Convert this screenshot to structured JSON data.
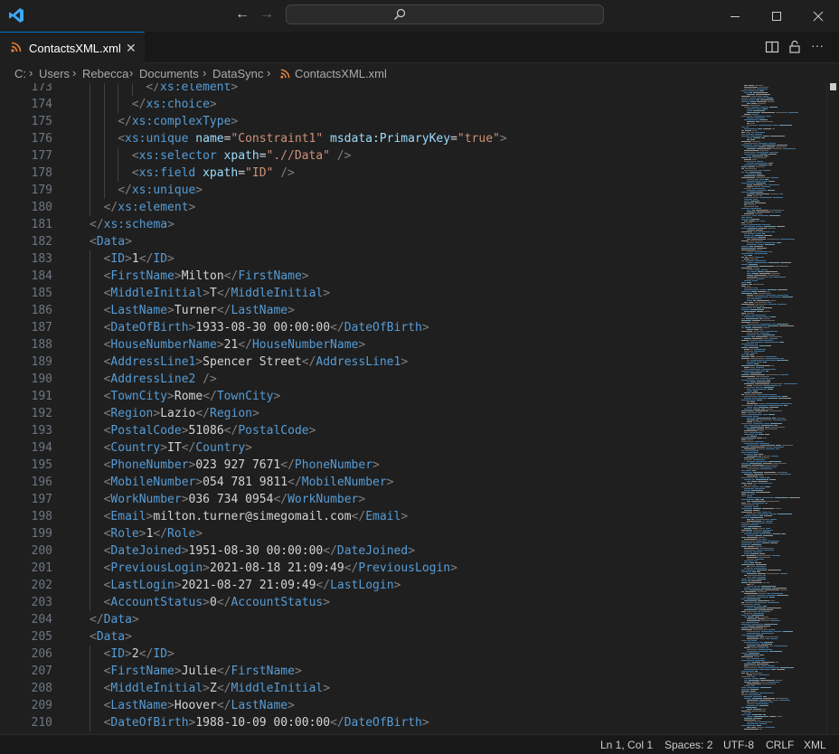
{
  "window": {
    "app_icon": "vscode-logo-icon",
    "nav_back_icon": "arrow-left-icon",
    "nav_forward_icon": "arrow-right-icon",
    "search_icon": "search-icon",
    "minimize_icon": "minimize-icon",
    "maximize_icon": "maximize-icon",
    "close_icon": "close-icon"
  },
  "tab": {
    "label": "ContactsXML.xml",
    "close": "✕",
    "icon": "rss-icon",
    "accent": "#0078d4"
  },
  "toolbar": {
    "split_icon": "split-editor-icon",
    "lock_icon": "lock-icon",
    "more": "···"
  },
  "breadcrumb": [
    "C:",
    "Users",
    "Rebecca",
    "Documents",
    "DataSync",
    "ContactsXML.xml"
  ],
  "lines": [
    {
      "n": "173",
      "indent": 4,
      "seg": [
        [
          "punct",
          "</"
        ],
        [
          "tag",
          "xs:element"
        ],
        [
          "punct",
          ">"
        ]
      ]
    },
    {
      "n": "174",
      "indent": 3,
      "seg": [
        [
          "punct",
          "</"
        ],
        [
          "tag",
          "xs:choice"
        ],
        [
          "punct",
          ">"
        ]
      ]
    },
    {
      "n": "175",
      "indent": 2,
      "seg": [
        [
          "punct",
          "</"
        ],
        [
          "tag",
          "xs:complexType"
        ],
        [
          "punct",
          ">"
        ]
      ]
    },
    {
      "n": "176",
      "indent": 2,
      "seg": [
        [
          "punct",
          "<"
        ],
        [
          "tag",
          "xs:unique"
        ],
        [
          "text",
          " "
        ],
        [
          "attr",
          "name"
        ],
        [
          "text",
          "="
        ],
        [
          "str",
          "\"Constraint1\""
        ],
        [
          "text",
          " "
        ],
        [
          "attr",
          "msdata:PrimaryKey"
        ],
        [
          "text",
          "="
        ],
        [
          "str",
          "\"true\""
        ],
        [
          "punct",
          ">"
        ]
      ]
    },
    {
      "n": "177",
      "indent": 3,
      "seg": [
        [
          "punct",
          "<"
        ],
        [
          "tag",
          "xs:selector"
        ],
        [
          "text",
          " "
        ],
        [
          "attr",
          "xpath"
        ],
        [
          "text",
          "="
        ],
        [
          "str",
          "\".//Data\""
        ],
        [
          "text",
          " "
        ],
        [
          "punct",
          "/>"
        ]
      ]
    },
    {
      "n": "178",
      "indent": 3,
      "seg": [
        [
          "punct",
          "<"
        ],
        [
          "tag",
          "xs:field"
        ],
        [
          "text",
          " "
        ],
        [
          "attr",
          "xpath"
        ],
        [
          "text",
          "="
        ],
        [
          "str",
          "\"ID\""
        ],
        [
          "text",
          " "
        ],
        [
          "punct",
          "/>"
        ]
      ]
    },
    {
      "n": "179",
      "indent": 2,
      "seg": [
        [
          "punct",
          "</"
        ],
        [
          "tag",
          "xs:unique"
        ],
        [
          "punct",
          ">"
        ]
      ]
    },
    {
      "n": "180",
      "indent": 1,
      "seg": [
        [
          "punct",
          "</"
        ],
        [
          "tag",
          "xs:element"
        ],
        [
          "punct",
          ">"
        ]
      ]
    },
    {
      "n": "181",
      "indent": 0,
      "seg": [
        [
          "punct",
          "</"
        ],
        [
          "tag",
          "xs:schema"
        ],
        [
          "punct",
          ">"
        ]
      ]
    },
    {
      "n": "182",
      "indent": 0,
      "seg": [
        [
          "punct",
          "<"
        ],
        [
          "tag",
          "Data"
        ],
        [
          "punct",
          ">"
        ]
      ]
    },
    {
      "n": "183",
      "indent": 1,
      "seg": [
        [
          "punct",
          "<"
        ],
        [
          "tag",
          "ID"
        ],
        [
          "punct",
          ">"
        ],
        [
          "text",
          "1"
        ],
        [
          "punct",
          "</"
        ],
        [
          "tag",
          "ID"
        ],
        [
          "punct",
          ">"
        ]
      ]
    },
    {
      "n": "184",
      "indent": 1,
      "seg": [
        [
          "punct",
          "<"
        ],
        [
          "tag",
          "FirstName"
        ],
        [
          "punct",
          ">"
        ],
        [
          "text",
          "Milton"
        ],
        [
          "punct",
          "</"
        ],
        [
          "tag",
          "FirstName"
        ],
        [
          "punct",
          ">"
        ]
      ]
    },
    {
      "n": "185",
      "indent": 1,
      "seg": [
        [
          "punct",
          "<"
        ],
        [
          "tag",
          "MiddleInitial"
        ],
        [
          "punct",
          ">"
        ],
        [
          "text",
          "T"
        ],
        [
          "punct",
          "</"
        ],
        [
          "tag",
          "MiddleInitial"
        ],
        [
          "punct",
          ">"
        ]
      ]
    },
    {
      "n": "186",
      "indent": 1,
      "seg": [
        [
          "punct",
          "<"
        ],
        [
          "tag",
          "LastName"
        ],
        [
          "punct",
          ">"
        ],
        [
          "text",
          "Turner"
        ],
        [
          "punct",
          "</"
        ],
        [
          "tag",
          "LastName"
        ],
        [
          "punct",
          ">"
        ]
      ]
    },
    {
      "n": "187",
      "indent": 1,
      "seg": [
        [
          "punct",
          "<"
        ],
        [
          "tag",
          "DateOfBirth"
        ],
        [
          "punct",
          ">"
        ],
        [
          "text",
          "1933-08-30 00:00:00"
        ],
        [
          "punct",
          "</"
        ],
        [
          "tag",
          "DateOfBirth"
        ],
        [
          "punct",
          ">"
        ]
      ]
    },
    {
      "n": "188",
      "indent": 1,
      "seg": [
        [
          "punct",
          "<"
        ],
        [
          "tag",
          "HouseNumberName"
        ],
        [
          "punct",
          ">"
        ],
        [
          "text",
          "21"
        ],
        [
          "punct",
          "</"
        ],
        [
          "tag",
          "HouseNumberName"
        ],
        [
          "punct",
          ">"
        ]
      ]
    },
    {
      "n": "189",
      "indent": 1,
      "seg": [
        [
          "punct",
          "<"
        ],
        [
          "tag",
          "AddressLine1"
        ],
        [
          "punct",
          ">"
        ],
        [
          "text",
          "Spencer Street"
        ],
        [
          "punct",
          "</"
        ],
        [
          "tag",
          "AddressLine1"
        ],
        [
          "punct",
          ">"
        ]
      ]
    },
    {
      "n": "190",
      "indent": 1,
      "seg": [
        [
          "punct",
          "<"
        ],
        [
          "tag",
          "AddressLine2"
        ],
        [
          "text",
          " "
        ],
        [
          "punct",
          "/>"
        ]
      ]
    },
    {
      "n": "191",
      "indent": 1,
      "seg": [
        [
          "punct",
          "<"
        ],
        [
          "tag",
          "TownCity"
        ],
        [
          "punct",
          ">"
        ],
        [
          "text",
          "Rome"
        ],
        [
          "punct",
          "</"
        ],
        [
          "tag",
          "TownCity"
        ],
        [
          "punct",
          ">"
        ]
      ]
    },
    {
      "n": "192",
      "indent": 1,
      "seg": [
        [
          "punct",
          "<"
        ],
        [
          "tag",
          "Region"
        ],
        [
          "punct",
          ">"
        ],
        [
          "text",
          "Lazio"
        ],
        [
          "punct",
          "</"
        ],
        [
          "tag",
          "Region"
        ],
        [
          "punct",
          ">"
        ]
      ]
    },
    {
      "n": "193",
      "indent": 1,
      "seg": [
        [
          "punct",
          "<"
        ],
        [
          "tag",
          "PostalCode"
        ],
        [
          "punct",
          ">"
        ],
        [
          "text",
          "51086"
        ],
        [
          "punct",
          "</"
        ],
        [
          "tag",
          "PostalCode"
        ],
        [
          "punct",
          ">"
        ]
      ]
    },
    {
      "n": "194",
      "indent": 1,
      "seg": [
        [
          "punct",
          "<"
        ],
        [
          "tag",
          "Country"
        ],
        [
          "punct",
          ">"
        ],
        [
          "text",
          "IT"
        ],
        [
          "punct",
          "</"
        ],
        [
          "tag",
          "Country"
        ],
        [
          "punct",
          ">"
        ]
      ]
    },
    {
      "n": "195",
      "indent": 1,
      "seg": [
        [
          "punct",
          "<"
        ],
        [
          "tag",
          "PhoneNumber"
        ],
        [
          "punct",
          ">"
        ],
        [
          "text",
          "023 927 7671"
        ],
        [
          "punct",
          "</"
        ],
        [
          "tag",
          "PhoneNumber"
        ],
        [
          "punct",
          ">"
        ]
      ]
    },
    {
      "n": "196",
      "indent": 1,
      "seg": [
        [
          "punct",
          "<"
        ],
        [
          "tag",
          "MobileNumber"
        ],
        [
          "punct",
          ">"
        ],
        [
          "text",
          "054 781 9811"
        ],
        [
          "punct",
          "</"
        ],
        [
          "tag",
          "MobileNumber"
        ],
        [
          "punct",
          ">"
        ]
      ]
    },
    {
      "n": "197",
      "indent": 1,
      "seg": [
        [
          "punct",
          "<"
        ],
        [
          "tag",
          "WorkNumber"
        ],
        [
          "punct",
          ">"
        ],
        [
          "text",
          "036 734 0954"
        ],
        [
          "punct",
          "</"
        ],
        [
          "tag",
          "WorkNumber"
        ],
        [
          "punct",
          ">"
        ]
      ]
    },
    {
      "n": "198",
      "indent": 1,
      "seg": [
        [
          "punct",
          "<"
        ],
        [
          "tag",
          "Email"
        ],
        [
          "punct",
          ">"
        ],
        [
          "text",
          "milton.turner@simegomail.com"
        ],
        [
          "punct",
          "</"
        ],
        [
          "tag",
          "Email"
        ],
        [
          "punct",
          ">"
        ]
      ]
    },
    {
      "n": "199",
      "indent": 1,
      "seg": [
        [
          "punct",
          "<"
        ],
        [
          "tag",
          "Role"
        ],
        [
          "punct",
          ">"
        ],
        [
          "text",
          "1"
        ],
        [
          "punct",
          "</"
        ],
        [
          "tag",
          "Role"
        ],
        [
          "punct",
          ">"
        ]
      ]
    },
    {
      "n": "200",
      "indent": 1,
      "seg": [
        [
          "punct",
          "<"
        ],
        [
          "tag",
          "DateJoined"
        ],
        [
          "punct",
          ">"
        ],
        [
          "text",
          "1951-08-30 00:00:00"
        ],
        [
          "punct",
          "</"
        ],
        [
          "tag",
          "DateJoined"
        ],
        [
          "punct",
          ">"
        ]
      ]
    },
    {
      "n": "201",
      "indent": 1,
      "seg": [
        [
          "punct",
          "<"
        ],
        [
          "tag",
          "PreviousLogin"
        ],
        [
          "punct",
          ">"
        ],
        [
          "text",
          "2021-08-18 21:09:49"
        ],
        [
          "punct",
          "</"
        ],
        [
          "tag",
          "PreviousLogin"
        ],
        [
          "punct",
          ">"
        ]
      ]
    },
    {
      "n": "202",
      "indent": 1,
      "seg": [
        [
          "punct",
          "<"
        ],
        [
          "tag",
          "LastLogin"
        ],
        [
          "punct",
          ">"
        ],
        [
          "text",
          "2021-08-27 21:09:49"
        ],
        [
          "punct",
          "</"
        ],
        [
          "tag",
          "LastLogin"
        ],
        [
          "punct",
          ">"
        ]
      ]
    },
    {
      "n": "203",
      "indent": 1,
      "seg": [
        [
          "punct",
          "<"
        ],
        [
          "tag",
          "AccountStatus"
        ],
        [
          "punct",
          ">"
        ],
        [
          "text",
          "0"
        ],
        [
          "punct",
          "</"
        ],
        [
          "tag",
          "AccountStatus"
        ],
        [
          "punct",
          ">"
        ]
      ]
    },
    {
      "n": "204",
      "indent": 0,
      "seg": [
        [
          "punct",
          "</"
        ],
        [
          "tag",
          "Data"
        ],
        [
          "punct",
          ">"
        ]
      ]
    },
    {
      "n": "205",
      "indent": 0,
      "seg": [
        [
          "punct",
          "<"
        ],
        [
          "tag",
          "Data"
        ],
        [
          "punct",
          ">"
        ]
      ]
    },
    {
      "n": "206",
      "indent": 1,
      "seg": [
        [
          "punct",
          "<"
        ],
        [
          "tag",
          "ID"
        ],
        [
          "punct",
          ">"
        ],
        [
          "text",
          "2"
        ],
        [
          "punct",
          "</"
        ],
        [
          "tag",
          "ID"
        ],
        [
          "punct",
          ">"
        ]
      ]
    },
    {
      "n": "207",
      "indent": 1,
      "seg": [
        [
          "punct",
          "<"
        ],
        [
          "tag",
          "FirstName"
        ],
        [
          "punct",
          ">"
        ],
        [
          "text",
          "Julie"
        ],
        [
          "punct",
          "</"
        ],
        [
          "tag",
          "FirstName"
        ],
        [
          "punct",
          ">"
        ]
      ]
    },
    {
      "n": "208",
      "indent": 1,
      "seg": [
        [
          "punct",
          "<"
        ],
        [
          "tag",
          "MiddleInitial"
        ],
        [
          "punct",
          ">"
        ],
        [
          "text",
          "Z"
        ],
        [
          "punct",
          "</"
        ],
        [
          "tag",
          "MiddleInitial"
        ],
        [
          "punct",
          ">"
        ]
      ]
    },
    {
      "n": "209",
      "indent": 1,
      "seg": [
        [
          "punct",
          "<"
        ],
        [
          "tag",
          "LastName"
        ],
        [
          "punct",
          ">"
        ],
        [
          "text",
          "Hoover"
        ],
        [
          "punct",
          "</"
        ],
        [
          "tag",
          "LastName"
        ],
        [
          "punct",
          ">"
        ]
      ]
    },
    {
      "n": "210",
      "indent": 1,
      "seg": [
        [
          "punct",
          "<"
        ],
        [
          "tag",
          "DateOfBirth"
        ],
        [
          "punct",
          ">"
        ],
        [
          "text",
          "1988-10-09 00:00:00"
        ],
        [
          "punct",
          "</"
        ],
        [
          "tag",
          "DateOfBirth"
        ],
        [
          "punct",
          ">"
        ]
      ]
    }
  ],
  "status": {
    "position": "Ln 1, Col 1",
    "spaces": "Spaces: 2",
    "encoding": "UTF-8",
    "eol": "CRLF",
    "language": "XML"
  },
  "colors": {
    "tag": "#569cd6",
    "attr": "#9cdcfe",
    "string": "#ce9178",
    "text": "#d4d4d4",
    "punct": "#808080",
    "rss": "#e8823a"
  }
}
